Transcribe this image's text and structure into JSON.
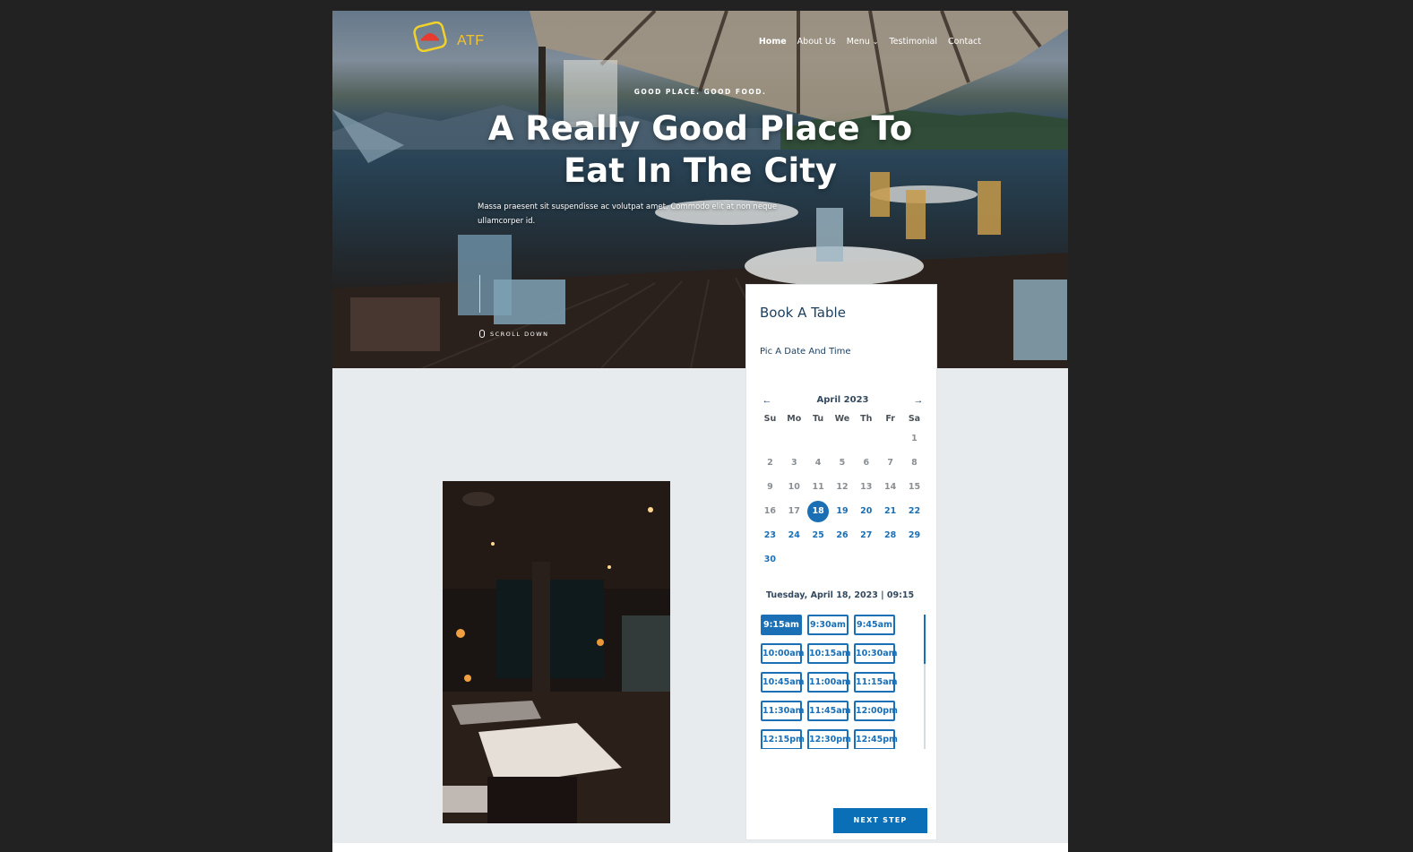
{
  "brand": {
    "name": "ATF"
  },
  "nav": {
    "items": [
      {
        "label": "Home"
      },
      {
        "label": "About Us"
      },
      {
        "label": "Menu"
      },
      {
        "label": "Testimonial"
      },
      {
        "label": "Contact"
      }
    ],
    "active": "Home",
    "menu_chevron_icon": "chevron-down-icon"
  },
  "hero": {
    "eyebrow": "GOOD PLACE. GOOD FOOD.",
    "headline_line1": "A Really Good Place To",
    "headline_line2": "Eat In The City",
    "lede": "Massa praesent sit suspendisse ac volutpat amet. Commodo elit at non neque ullamcorper id.",
    "scroll_label": "SCROLL DOWN",
    "scroll_icon": "mouse-icon"
  },
  "booking": {
    "title": "Book A Table",
    "subtitle": "Pic A Date And Time",
    "calendar": {
      "month": "April 2023",
      "prev_icon": "arrow-left-icon",
      "next_icon": "arrow-right-icon",
      "weekdays": [
        "Su",
        "Mo",
        "Tu",
        "We",
        "Th",
        "Fr",
        "Sa"
      ],
      "weeks": [
        [
          "",
          "",
          "",
          "",
          "",
          "",
          "1"
        ],
        [
          "2",
          "3",
          "4",
          "5",
          "6",
          "7",
          "8"
        ],
        [
          "9",
          "10",
          "11",
          "12",
          "13",
          "14",
          "15"
        ],
        [
          "16",
          "17",
          "18",
          "19",
          "20",
          "21",
          "22"
        ],
        [
          "23",
          "24",
          "25",
          "26",
          "27",
          "28",
          "29"
        ],
        [
          "30",
          "",
          "",
          "",
          "",
          "",
          ""
        ]
      ],
      "selected": "18",
      "available_from": 18
    },
    "selected_datetime": "Tuesday, April 18, 2023 | 09:15",
    "time_slots": [
      [
        "9:15am",
        "9:30am",
        "9:45am"
      ],
      [
        "10:00am",
        "10:15am",
        "10:30am"
      ],
      [
        "10:45am",
        "11:00am",
        "11:15am"
      ],
      [
        "11:30am",
        "11:45am",
        "12:00pm"
      ],
      [
        "12:15pm",
        "12:30pm",
        "12:45pm"
      ]
    ],
    "selected_slot": "9:15am",
    "next_label": "NEXT STEP"
  },
  "colors": {
    "accent": "#1a6fb5",
    "brand": "#f2c230",
    "logo_red": "#e63b2e",
    "heading": "#1c3f5e",
    "page_bg": "#e8ebee",
    "outer_bg": "#222222"
  }
}
